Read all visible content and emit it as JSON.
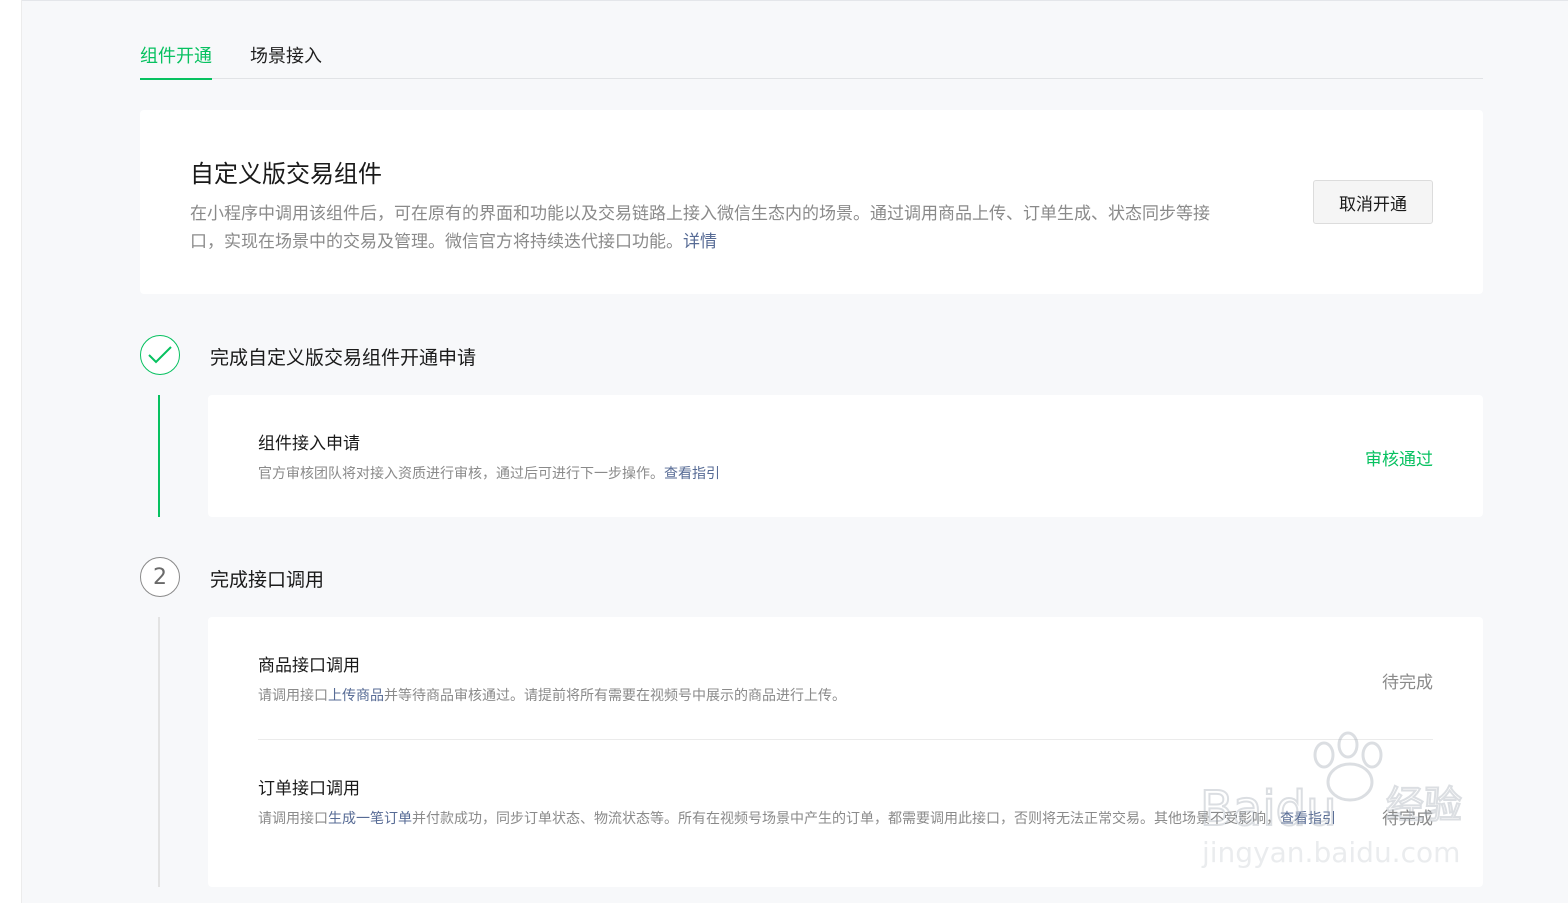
{
  "tabs": [
    {
      "label": "组件开通",
      "active": true
    },
    {
      "label": "场景接入",
      "active": false
    }
  ],
  "intro": {
    "title": "自定义版交易组件",
    "desc": "在小程序中调用该组件后，可在原有的界面和功能以及交易链路上接入微信生态内的场景。通过调用商品上传、订单生成、状态同步等接口，实现在场景中的交易及管理。微信官方将持续迭代接口功能。",
    "detail_link": "详情",
    "cancel_label": "取消开通"
  },
  "steps": [
    {
      "number": "1",
      "state": "done",
      "title": "完成自定义版交易组件开通申请",
      "items": [
        {
          "title": "组件接入申请",
          "desc": "官方审核团队将对接入资质进行审核，通过后可进行下一步操作。",
          "link": "查看指引",
          "status": "审核通过"
        }
      ]
    },
    {
      "number": "2",
      "state": "pending",
      "title": "完成接口调用",
      "items": [
        {
          "title": "商品接口调用",
          "desc_pre": "请调用接口",
          "desc_link": "上传商品",
          "desc_post": "并等待商品审核通过。请提前将所有需要在视频号中展示的商品进行上传。",
          "status": "待完成"
        },
        {
          "title": "订单接口调用",
          "desc_pre": "请调用接口",
          "desc_link": "生成一笔订单",
          "desc_post": "并付款成功，同步订单状态、物流状态等。所有在视频号场景中产生的订单，都需要调用此接口，否则将无法正常交易。其他场景不受影响，",
          "link": "查看指引",
          "status": "待完成"
        }
      ]
    }
  ],
  "colors": {
    "accent_green": "#07c160",
    "link_blue": "#576b95",
    "muted_gray": "#8a8a8a"
  },
  "watermark": {
    "text_main": "Baidu",
    "text_cn": "经验",
    "text_url": "jingyan.baidu.com"
  }
}
